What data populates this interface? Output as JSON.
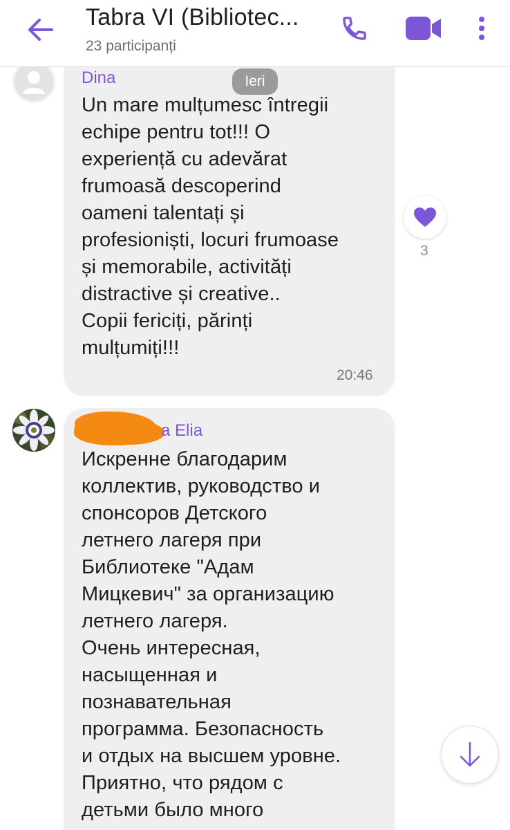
{
  "header": {
    "title": "Tabra VI (Bibliotec...",
    "subtitle": "23 participanți",
    "accent_color": "#7c55d8",
    "icons": [
      "back-arrow-icon",
      "phone-icon",
      "video-camera-icon",
      "more-vertical-icon"
    ]
  },
  "date_separator": "Ieri",
  "messages": [
    {
      "sender": "Dina",
      "text": "Un mare mulțumesc întregii\nechipe pentru tot!!! O\nexperiență cu adevărat\nfrumoasă descoperind\noameni talentați  și\nprofesioniști, locuri frumoase\nși memorabile, activități\ndistractive și creative..\nCopii fericiți,  părinți\nmulțumiți!!!",
      "time": "20:46",
      "reaction": {
        "icon": "heart-icon",
        "count": "3",
        "color": "#7c55d8"
      }
    },
    {
      "sender": "a Elia",
      "text": "Искренне благодарим\nколлектив, руководство и\nспонсоров Детского\nлетнего лагеря при\nБиблиотеке \"Адам\nМицкевич\" за организацию\nлетнего лагеря.\nОчень интересная,\nнасыщенная  и\nпознавательная\nпрограмма. Безопасность\nи отдых на высшем уровне.\nПриятно, что рядом с\nдетьми было много"
    }
  ]
}
